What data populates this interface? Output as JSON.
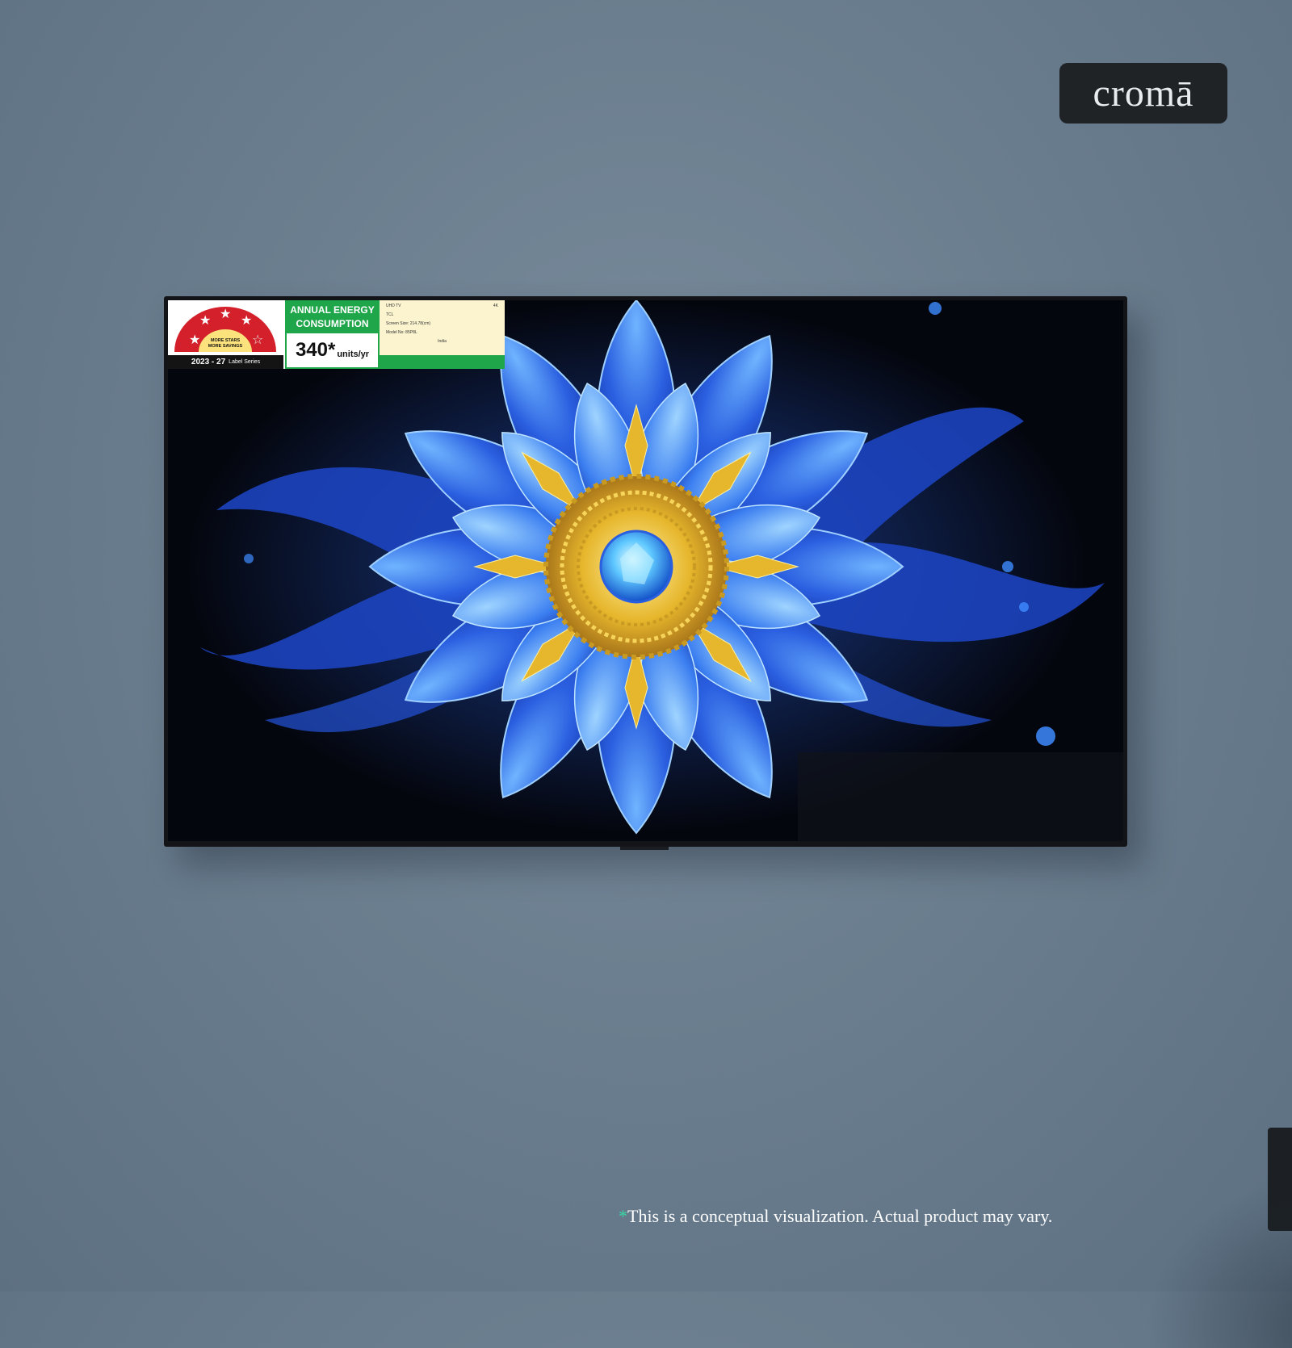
{
  "brand": {
    "logo_text": "cromā"
  },
  "energy_label": {
    "stars_rated": 4,
    "stars_total": 5,
    "arc_text_1": "MORE STARS",
    "arc_text_2": "MORE SAVINGS",
    "series_year": "2023 - 27",
    "series_suffix": "Label Series",
    "energy_heading_1": "ANNUAL ENERGY",
    "energy_heading_2": "CONSUMPTION",
    "energy_value": "340*",
    "energy_unit": "units/yr",
    "info": {
      "type": "UHD TV",
      "resolution": "4K",
      "brand": "TCL",
      "screen_size": "Screen Size: 214.78(cm)",
      "model": "Model No: 85P8L",
      "country": "India"
    }
  },
  "disclaimer": {
    "asterisk": "*",
    "text": "This is a conceptual visualization. Actual product may vary."
  },
  "colors": {
    "wall": "#6b7e8f",
    "label_green": "#1fa64a",
    "label_red": "#d3202a",
    "flower_blue": "#1f4fd8",
    "flower_gold": "#e0b52a",
    "accent_teal": "#3ad6a4"
  }
}
